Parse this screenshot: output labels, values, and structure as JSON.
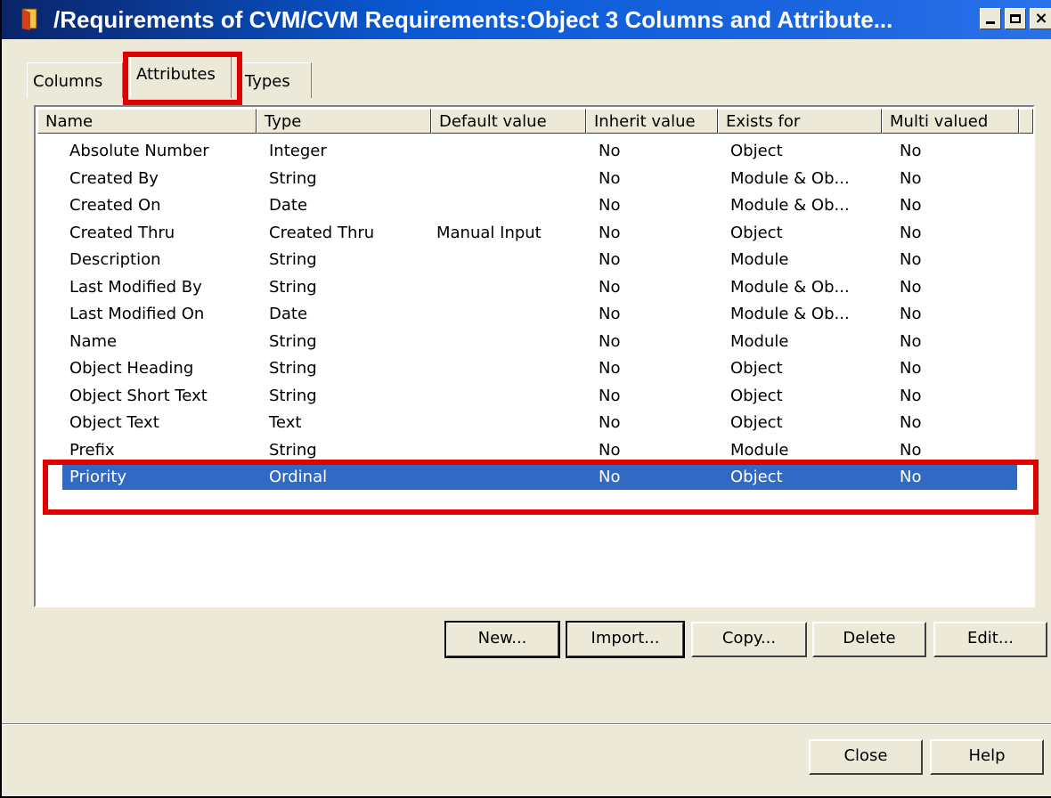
{
  "window": {
    "title": "/Requirements of CVM/CVM Requirements:Object 3 Columns and Attribute..."
  },
  "tabs": [
    {
      "label": "Columns"
    },
    {
      "label": "Attributes"
    },
    {
      "label": "Types"
    }
  ],
  "list": {
    "columns": [
      "Name",
      "Type",
      "Default value",
      "Inherit value",
      "Exists for",
      "Multi valued"
    ],
    "rows": [
      [
        "Absolute Number",
        "Integer",
        "",
        "No",
        "Object",
        "No"
      ],
      [
        "Created By",
        "String",
        "",
        "No",
        "Module & Ob...",
        "No"
      ],
      [
        "Created On",
        "Date",
        "",
        "No",
        "Module & Ob...",
        "No"
      ],
      [
        "Created Thru",
        "Created Thru",
        "Manual Input",
        "No",
        "Object",
        "No"
      ],
      [
        "Description",
        "String",
        "",
        "No",
        "Module",
        "No"
      ],
      [
        "Last Modified By",
        "String",
        "",
        "No",
        "Module & Ob...",
        "No"
      ],
      [
        "Last Modified On",
        "Date",
        "",
        "No",
        "Module & Ob...",
        "No"
      ],
      [
        "Name",
        "String",
        "",
        "No",
        "Module",
        "No"
      ],
      [
        "Object Heading",
        "String",
        "",
        "No",
        "Object",
        "No"
      ],
      [
        "Object Short Text",
        "String",
        "",
        "No",
        "Object",
        "No"
      ],
      [
        "Object Text",
        "Text",
        "",
        "No",
        "Object",
        "No"
      ],
      [
        "Prefix",
        "String",
        "",
        "No",
        "Module",
        "No"
      ],
      [
        "Priority",
        "Ordinal",
        "",
        "No",
        "Object",
        "No"
      ]
    ],
    "selected_row": "Priority"
  },
  "buttons": {
    "new": "New...",
    "import": "Import...",
    "copy": "Copy...",
    "delete": "Delete",
    "edit": "Edit...",
    "close": "Close",
    "help": "Help"
  },
  "colors": {
    "highlight": "#e00000",
    "selection": "#316ac5",
    "titlebar": "#0a5ad6"
  }
}
